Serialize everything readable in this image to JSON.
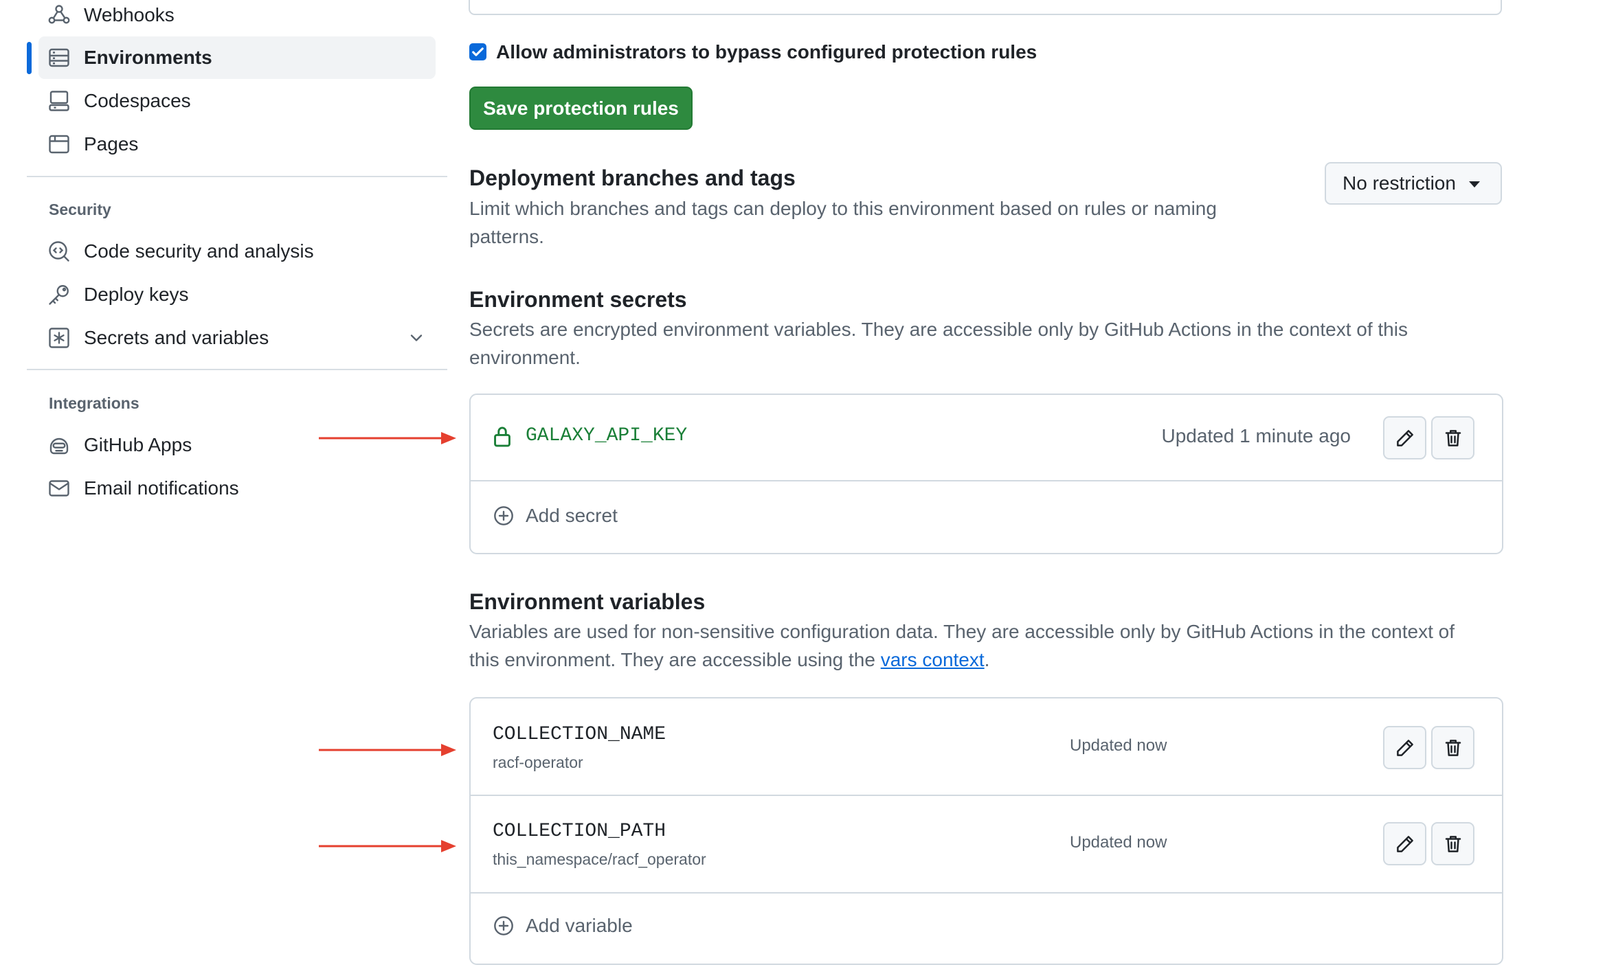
{
  "sidebar": {
    "items_top": [
      {
        "label": "Webhooks",
        "icon": "webhook-icon"
      },
      {
        "label": "Environments",
        "icon": "server-icon",
        "active": true
      },
      {
        "label": "Codespaces",
        "icon": "codespaces-icon"
      },
      {
        "label": "Pages",
        "icon": "browser-icon"
      }
    ],
    "security_heading": "Security",
    "security_items": [
      {
        "label": "Code security and analysis",
        "icon": "codescan-icon"
      },
      {
        "label": "Deploy keys",
        "icon": "key-icon"
      },
      {
        "label": "Secrets and variables",
        "icon": "key-asterisk-icon"
      }
    ],
    "integrations_heading": "Integrations",
    "integrations_items": [
      {
        "label": "GitHub Apps",
        "icon": "hubot-icon"
      },
      {
        "label": "Email notifications",
        "icon": "mail-icon"
      }
    ]
  },
  "protection": {
    "bypass_checked": true,
    "bypass_label": "Allow administrators to bypass configured protection rules",
    "save_label": "Save protection rules"
  },
  "deployment_branches": {
    "title": "Deployment branches and tags",
    "desc_line1": "Limit which branches and tags can deploy to this environment based on rules or naming",
    "desc_line2": "patterns.",
    "dropdown_value": "No restriction"
  },
  "secrets": {
    "title": "Environment secrets",
    "desc_line1": "Secrets are encrypted environment variables. They are accessible only by GitHub Actions in the context of this",
    "desc_line2": "environment.",
    "items": [
      {
        "name": "GALAXY_API_KEY",
        "updated": "Updated 1 minute ago"
      }
    ],
    "add_label": "Add secret"
  },
  "variables": {
    "title": "Environment variables",
    "desc_line1": "Variables are used for non-sensitive configuration data. They are accessible only by GitHub Actions in the context of",
    "desc_line2_prefix": "this environment. They are accessible using the ",
    "desc_link": "vars context",
    "desc_line2_suffix": ".",
    "items": [
      {
        "name": "COLLECTION_NAME",
        "value": "racf-operator",
        "updated": "Updated now"
      },
      {
        "name": "COLLECTION_PATH",
        "value": "this_namespace/racf_operator",
        "updated": "Updated now"
      }
    ],
    "add_label": "Add variable"
  },
  "colors": {
    "accent": "#0969da",
    "primary_button": "#2e8a3f",
    "secret_name": "#1a7f37",
    "annotation_arrow": "#e5402f"
  }
}
